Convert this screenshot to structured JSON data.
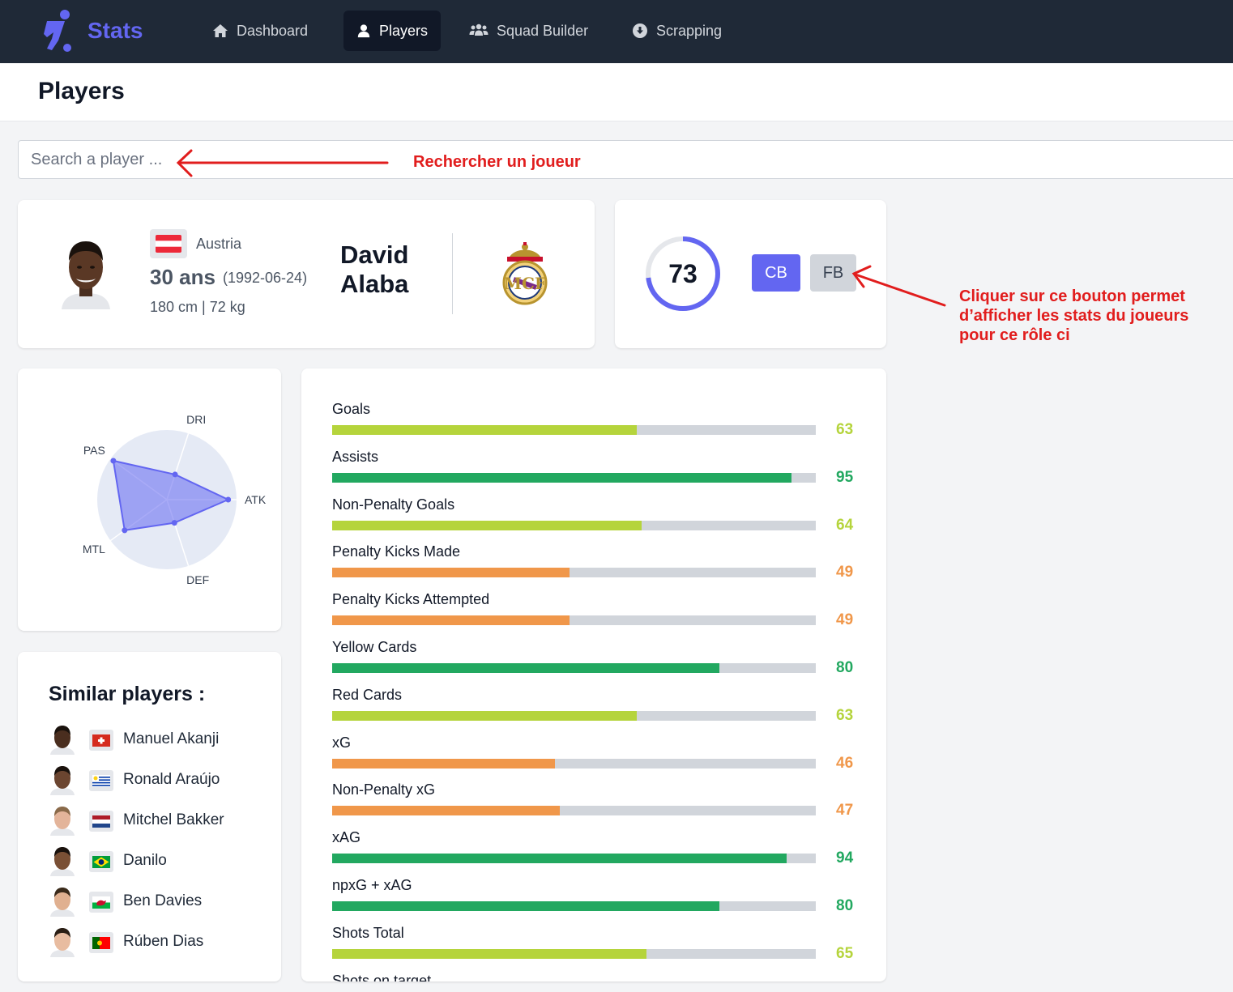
{
  "app": {
    "brand": "Stats"
  },
  "nav": [
    {
      "label": "Dashboard",
      "icon": "home-icon",
      "active": false
    },
    {
      "label": "Players",
      "icon": "user-icon",
      "active": true
    },
    {
      "label": "Squad Builder",
      "icon": "users-group-icon",
      "active": false
    },
    {
      "label": "Scrapping",
      "icon": "download-circle-icon",
      "active": false
    }
  ],
  "page": {
    "title": "Players"
  },
  "search": {
    "placeholder": "Search a player ...",
    "value": ""
  },
  "annotations": {
    "search": "Rechercher un joueur",
    "role_line1": "Cliquer sur ce bouton permet",
    "role_line2": "d’afficher les stats du joueurs",
    "role_line3": "pour ce rôle ci"
  },
  "player": {
    "country": "Austria",
    "age": "30 ans",
    "birthdate": "(1992-06-24)",
    "height": "180 cm",
    "weight": "72 kg",
    "first_name": "David",
    "last_name": "Alaba",
    "club_logo": "real-madrid-crest"
  },
  "rating": {
    "value": 73,
    "max": 100
  },
  "roles": [
    {
      "label": "CB",
      "active": true
    },
    {
      "label": "FB",
      "active": false
    }
  ],
  "radar": {
    "axes": [
      "DRI",
      "ATK",
      "DEF",
      "MTL",
      "PAS"
    ],
    "values": [
      38,
      88,
      35,
      75,
      95
    ],
    "max": 100
  },
  "similar": {
    "title": "Similar players :",
    "players": [
      {
        "name": "Manuel Akanji",
        "flag": "switzerland"
      },
      {
        "name": "Ronald Araújo",
        "flag": "uruguay"
      },
      {
        "name": "Mitchel Bakker",
        "flag": "netherlands"
      },
      {
        "name": "Danilo",
        "flag": "brazil"
      },
      {
        "name": "Ben Davies",
        "flag": "wales"
      },
      {
        "name": "Rúben Dias",
        "flag": "portugal"
      }
    ]
  },
  "colors": {
    "accent": "#6366f1",
    "high": "#22a860",
    "mid": "#b5d43c",
    "low": "#f0974a",
    "navbar": "#1f2937",
    "annotation": "#e11d1d"
  },
  "stats": [
    {
      "label": "Goals",
      "value": 63
    },
    {
      "label": "Assists",
      "value": 95
    },
    {
      "label": "Non-Penalty Goals",
      "value": 64
    },
    {
      "label": "Penalty Kicks Made",
      "value": 49
    },
    {
      "label": "Penalty Kicks Attempted",
      "value": 49
    },
    {
      "label": "Yellow Cards",
      "value": 80
    },
    {
      "label": "Red Cards",
      "value": 63
    },
    {
      "label": "xG",
      "value": 46
    },
    {
      "label": "Non-Penalty xG",
      "value": 47
    },
    {
      "label": "xAG",
      "value": 94
    },
    {
      "label": "npxG + xAG",
      "value": 80
    },
    {
      "label": "Shots Total",
      "value": 65
    },
    {
      "label": "Shots on target",
      "value": null
    }
  ]
}
